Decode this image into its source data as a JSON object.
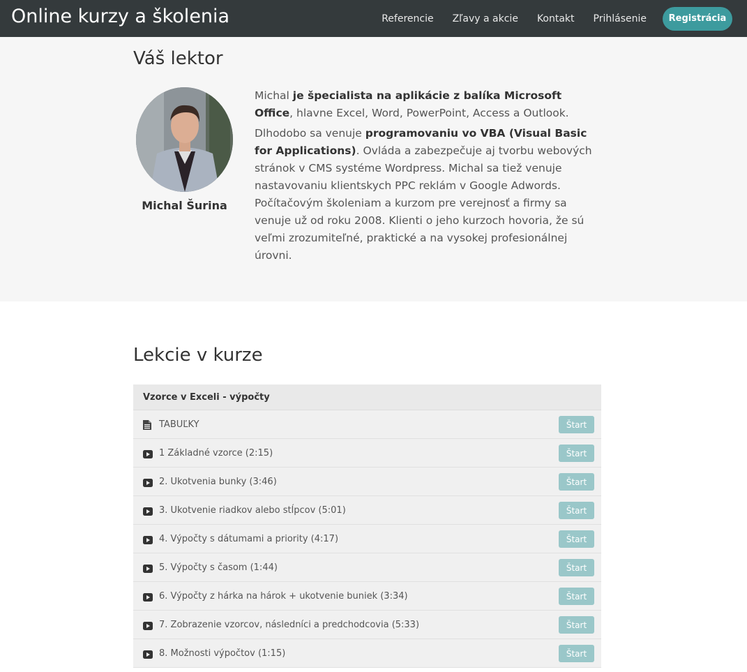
{
  "navbar": {
    "brand": "Online kurzy a školenia",
    "links": [
      "Referencie",
      "Zľavy a akcie",
      "Kontakt",
      "Prihlásenie"
    ],
    "register_label": "Registrácia"
  },
  "lector": {
    "title": "Váš lektor",
    "name": "Michal Šurina",
    "bio_p1_a": "Michal ",
    "bio_p1_b": "je špecialista na aplikácie z balíka Microsoft Office",
    "bio_p1_c": ", hlavne Excel, Word, PowerPoint, Access a Outlook.",
    "bio_p2_a": "Dlhodobo sa venuje ",
    "bio_p2_b": "programovaniu vo VBA (Visual Basic for Applications)",
    "bio_p2_c": ". Ovláda a zabezpečuje aj tvorbu webových stránok v CMS systéme Wordpress. Michal sa tiež venuje nastavovaniu klientskych PPC reklám v Google Adwords. Počítačovým školeniam a kurzom pre verejnosť a firmy sa venuje už od roku 2008. Klienti o jeho kurzoch hovoria, že sú veľmi zrozumiteľné, praktické a na vysokej profesionálnej úrovni."
  },
  "lessons": {
    "title": "Lekcie v kurze",
    "section_name": "Vzorce v Exceli - výpočty",
    "start_label": "Štart",
    "items": [
      {
        "label": "TABUĽKY",
        "icon": "document-icon"
      },
      {
        "label": "1 Základné vzorce (2:15)",
        "icon": "video-icon"
      },
      {
        "label": "2. Ukotvenia bunky (3:46)",
        "icon": "video-icon"
      },
      {
        "label": "3. Ukotvenie riadkov alebo stĺpcov (5:01)",
        "icon": "video-icon"
      },
      {
        "label": "4. Výpočty s dátumami a priority (4:17)",
        "icon": "video-icon"
      },
      {
        "label": "5. Výpočty s časom (1:44)",
        "icon": "video-icon"
      },
      {
        "label": "6. Výpočty z hárka na hárok + ukotvenie buniek (3:34)",
        "icon": "video-icon"
      },
      {
        "label": "7. Zobrazenie vzorcov, následníci a predchodcovia (5:33)",
        "icon": "video-icon"
      },
      {
        "label": "8. Možnosti výpočtov (1:15)",
        "icon": "video-icon"
      }
    ]
  },
  "colors": {
    "navbar_bg": "#343a3c",
    "accent": "#3d9b9e",
    "start_button": "#9ac7c9",
    "lector_bg": "#f6f6f6"
  }
}
